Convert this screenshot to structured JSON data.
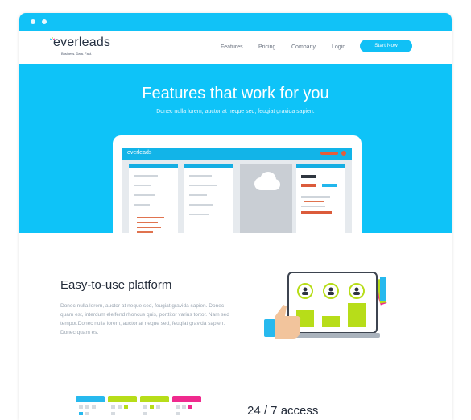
{
  "brand": {
    "name": "everleads",
    "tagline": "Business. Data. Fast.",
    "accent": "#10c0f6"
  },
  "nav": {
    "links": [
      "Features",
      "Pricing",
      "Company",
      "Login"
    ],
    "cta": "Start Now"
  },
  "hero": {
    "title": "Features that work for you",
    "subtitle": "Donec nulla lorem, auctor at neque sed, feugiat gravida sapien.",
    "mockup_logo": "everleads"
  },
  "feature_platform": {
    "title": "Easy-to-use platform",
    "body": "Donec nulla lorem, auctor at neque sed, feugiat gravida sapien. Donec quam est, interdum eleifend rhoncus quis, porttitor varius tortor. Nam sed tempor.Donec nulla lorem, auctor at neque sed, feugiat gravida sapien. Donec quam es."
  },
  "feature_access": {
    "title": "24 / 7 access"
  },
  "calendar_colors": [
    "#27b9ee",
    "#b7dd19",
    "#b7dd19",
    "#ef2a8e"
  ],
  "icons": [
    "spark-icon",
    "cloud-icon",
    "user-icon",
    "thumbs-up-icon",
    "laptop-icon",
    "calendar-icon"
  ]
}
